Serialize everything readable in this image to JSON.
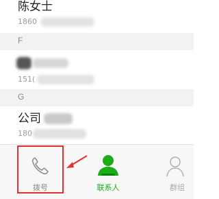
{
  "contacts": [
    {
      "name": "陈女士",
      "number": "1860"
    }
  ],
  "sections": [
    {
      "letter": "F",
      "contacts": [
        {
          "name": "",
          "number": "151("
        }
      ]
    },
    {
      "letter": "G",
      "contacts": [
        {
          "name": "公司",
          "number": "180"
        }
      ]
    }
  ],
  "tabbar": {
    "tabs": [
      {
        "label": "拨号",
        "icon": "phone-icon",
        "active": false,
        "highlighted": true
      },
      {
        "label": "联系人",
        "icon": "person-icon",
        "active": true
      },
      {
        "label": "群组",
        "icon": "group-icon",
        "active": false
      }
    ]
  },
  "colors": {
    "accent": "#1aad19",
    "highlight_box": "#e2322b",
    "arrow": "#e2322b"
  }
}
